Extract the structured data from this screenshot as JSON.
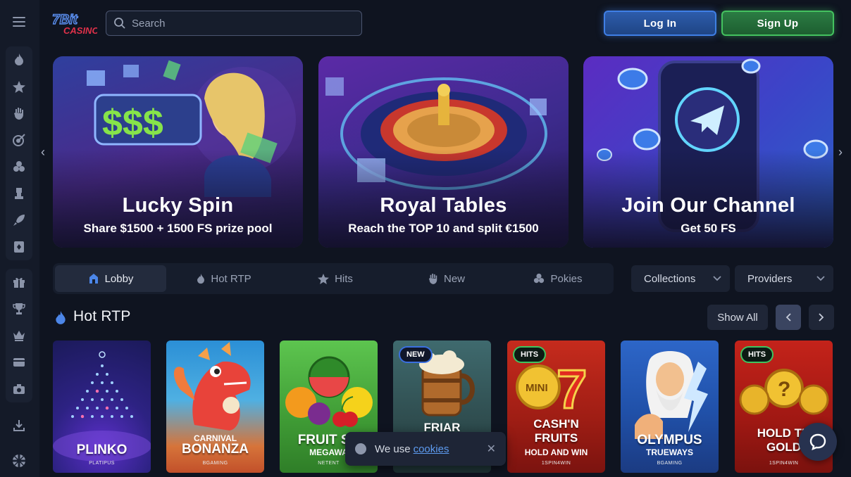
{
  "header": {
    "logo_text": "7Bit CASINO",
    "search_placeholder": "Search",
    "login_label": "Log In",
    "signup_label": "Sign Up"
  },
  "sidebar": {
    "top_icons": [
      "fire-icon",
      "star-icon",
      "hand-icon",
      "target-icon",
      "cards-icon",
      "chess-pawn-icon",
      "rocket-icon",
      "card-suit-icon"
    ],
    "bottom_icons": [
      "gift-icon",
      "trophy-icon",
      "crown-icon",
      "card-icon",
      "camera-icon"
    ],
    "footer_icons": [
      "download-icon",
      "uk-flag-icon"
    ]
  },
  "banners": [
    {
      "title": "Lucky Spin",
      "subtitle": "Share $1500 + 1500 FS prize pool"
    },
    {
      "title": "Royal Tables",
      "subtitle": "Reach the TOP 10 and split €1500"
    },
    {
      "title": "Join Our Channel",
      "subtitle": "Get 50 FS"
    }
  ],
  "tabs": [
    {
      "label": "Lobby",
      "icon": "lobby-icon",
      "active": true
    },
    {
      "label": "Hot RTP",
      "icon": "fire-icon",
      "active": false
    },
    {
      "label": "Hits",
      "icon": "star-icon",
      "active": false
    },
    {
      "label": "New",
      "icon": "hand-icon",
      "active": false
    },
    {
      "label": "Pokies",
      "icon": "cherry-icon",
      "active": false
    }
  ],
  "filters": {
    "collections": "Collections",
    "providers": "Providers"
  },
  "section": {
    "title": "Hot RTP",
    "show_all": "Show All"
  },
  "games": [
    {
      "title": "PLINKO",
      "subtitle": "",
      "provider": "PLATIPUS",
      "badge": ""
    },
    {
      "title": "BONANZA",
      "subtitle": "CARNIVAL",
      "provider": "BGAMING",
      "badge": ""
    },
    {
      "title": "FRUIT SH",
      "subtitle": "MEGAWA",
      "provider": "NETENT",
      "badge": ""
    },
    {
      "title": "FRIAR",
      "subtitle": "",
      "provider": "",
      "badge": "NEW"
    },
    {
      "title": "CASH'N FRUITS",
      "subtitle": "HOLD AND WIN",
      "provider": "1SPIN4WIN",
      "badge": "HITS"
    },
    {
      "title": "OLYMPUS",
      "subtitle": "TRUEWAYS",
      "provider": "BGAMING",
      "badge": ""
    },
    {
      "title": "HOLD TH GOLD",
      "subtitle": "",
      "provider": "1SPIN4WIN",
      "badge": "HITS"
    }
  ],
  "cookie": {
    "text": "We use",
    "link": "cookies"
  },
  "colors": {
    "background": "#0f1420",
    "login_accent": "#3f7fe6",
    "signup_accent": "#44c25f"
  }
}
